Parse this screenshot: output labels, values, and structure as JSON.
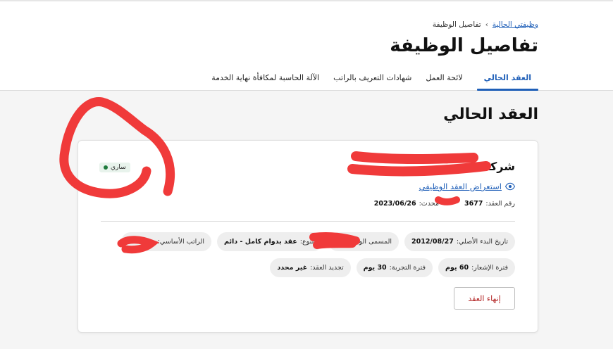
{
  "breadcrumb": {
    "root": "وظيفتي الحالية",
    "separator": "›",
    "current": "تفاصيل الوظيفة"
  },
  "page_title": "تفاصيل الوظيفة",
  "tabs": [
    {
      "label": "العقد الحالي",
      "active": true
    },
    {
      "label": "لائحة العمل",
      "active": false
    },
    {
      "label": "شهادات التعريف بالراتب",
      "active": false
    },
    {
      "label": "الآلة الحاسبة لمكافأة نهاية الخدمة",
      "active": false
    }
  ],
  "section_title": "العقد الحالي",
  "contract": {
    "company_name": "شركه",
    "status": "ساري",
    "view_link": "استعراض العقد الوظيفي",
    "number_label": "رقم العقد:",
    "number_value": "3677",
    "updated_label": "محدث:",
    "updated_value": "2023/06/26",
    "chips_row1": [
      {
        "label": "تاريخ البدء الأصلي:",
        "value": "2012/08/27"
      },
      {
        "label": "المسمى الوظيفي:",
        "value": ""
      },
      {
        "label": "النوع:",
        "value": "عقد بدوام كامل - دائم"
      },
      {
        "label": "الراتب الأساسي:",
        "value": ""
      }
    ],
    "chips_row2": [
      {
        "label": "فترة الإشعار:",
        "value": "60 يوم"
      },
      {
        "label": "فترة التجربة:",
        "value": "30 يوم"
      },
      {
        "label": "تجديد العقد:",
        "value": "غير محدد"
      }
    ],
    "end_button": "إنهاء العقد"
  },
  "colors": {
    "accent": "#1f5fb8",
    "danger": "#b22222",
    "status_dot": "#1e7a3c",
    "annotation": "#f03a3a"
  }
}
